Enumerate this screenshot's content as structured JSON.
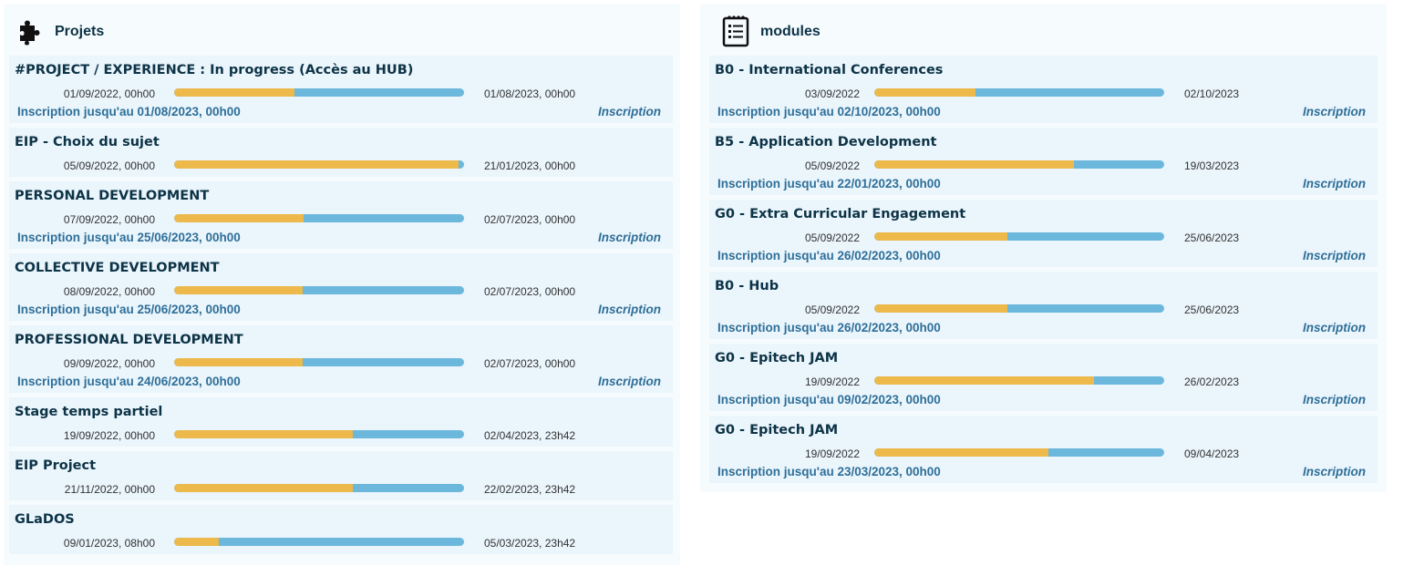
{
  "projets": {
    "title": "Projets",
    "items": [
      {
        "title": "#PROJECT / EXPERIENCE : In progress (Accès au HUB)",
        "start": "01/09/2022, 00h00",
        "end": "01/08/2023, 00h00",
        "progress": 0.415,
        "inscription_text": "Inscription jusqu'au 01/08/2023, 00h00",
        "inscription_link": "Inscription"
      },
      {
        "title": "EIP - Choix du sujet",
        "start": "05/09/2022, 00h00",
        "end": "21/01/2023, 00h00",
        "progress": 0.98
      },
      {
        "title": "PERSONAL DEVELOPMENT",
        "start": "07/09/2022, 00h00",
        "end": "02/07/2023, 00h00",
        "progress": 0.447,
        "inscription_text": "Inscription jusqu'au 25/06/2023, 00h00",
        "inscription_link": "Inscription"
      },
      {
        "title": "COLLECTIVE DEVELOPMENT",
        "start": "08/09/2022, 00h00",
        "end": "02/07/2023, 00h00",
        "progress": 0.443,
        "inscription_text": "Inscription jusqu'au 25/06/2023, 00h00",
        "inscription_link": "Inscription"
      },
      {
        "title": "PROFESSIONAL DEVELOPMENT",
        "start": "09/09/2022, 00h00",
        "end": "02/07/2023, 00h00",
        "progress": 0.443,
        "inscription_text": "Inscription jusqu'au 24/06/2023, 00h00",
        "inscription_link": "Inscription"
      },
      {
        "title": "Stage temps partiel",
        "start": "19/09/2022, 00h00",
        "end": "02/04/2023, 23h42",
        "progress": 0.616
      },
      {
        "title": "EIP Project",
        "start": "21/11/2022, 00h00",
        "end": "22/02/2023, 23h42",
        "progress": 0.616
      },
      {
        "title": "GLaDOS",
        "start": "09/01/2023, 08h00",
        "end": "05/03/2023, 23h42",
        "progress": 0.154
      }
    ]
  },
  "modules": {
    "title": "modules",
    "items": [
      {
        "title": "B0 - International Conferences",
        "start": "03/09/2022",
        "end": "02/10/2023",
        "progress": 0.348,
        "inscription_text": "Inscription jusqu'au 02/10/2023, 00h00",
        "inscription_link": "Inscription"
      },
      {
        "title": "B5 - Application Development",
        "start": "05/09/2022",
        "end": "19/03/2023",
        "progress": 0.69,
        "inscription_text": "Inscription jusqu'au 22/01/2023, 00h00",
        "inscription_link": "Inscription"
      },
      {
        "title": "G0 - Extra Curricular Engagement",
        "start": "05/09/2022",
        "end": "25/06/2023",
        "progress": 0.46,
        "inscription_text": "Inscription jusqu'au 26/02/2023, 00h00",
        "inscription_link": "Inscription"
      },
      {
        "title": "B0 - Hub",
        "start": "05/09/2022",
        "end": "25/06/2023",
        "progress": 0.46,
        "inscription_text": "Inscription jusqu'au 26/02/2023, 00h00",
        "inscription_link": "Inscription"
      },
      {
        "title": "G0 - Epitech JAM",
        "start": "19/09/2022",
        "end": "26/02/2023",
        "progress": 0.757,
        "inscription_text": "Inscription jusqu'au 09/02/2023, 00h00",
        "inscription_link": "Inscription"
      },
      {
        "title": "G0 - Epitech JAM",
        "start": "19/09/2022",
        "end": "09/04/2023",
        "progress": 0.6,
        "inscription_text": "Inscription jusqu'au 23/03/2023, 00h00",
        "inscription_link": "Inscription"
      }
    ]
  },
  "colors": {
    "progress_done": "#ecb94a",
    "progress_remaining": "#6cb8dc",
    "link": "#2f6f98",
    "title": "#0d3346"
  },
  "icons": {
    "projets": "puzzle-icon",
    "modules": "checklist-icon"
  }
}
